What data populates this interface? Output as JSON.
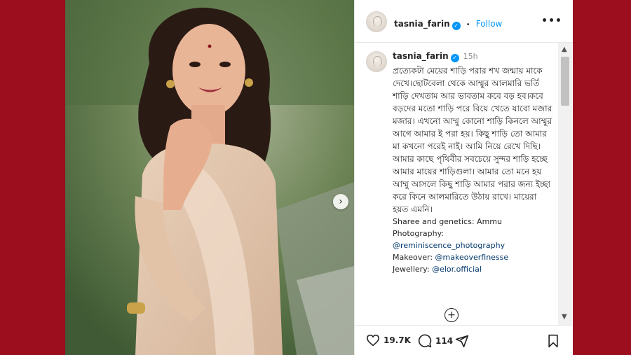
{
  "post": {
    "username": "tasnia_farin",
    "verified_symbol": "✓",
    "separator": "•",
    "follow_label": "Follow",
    "more_symbol": "•••",
    "time_ago": "15h",
    "caption": "প্রত্যেকটা মেয়ের শাড়ি পরার শখ জন্মায় মাকে দেখে।ছোটবেলা থেকে আম্মুর আলমারি ভর্তি শাড়ি দেখতাম আর ভাবতাম কবে বড় হব।কবে বড়দের মতো শাড়ি পরে বিয়ে খেতে যাবো মজার মজার। এখনো আম্মু কোনো শাড়ি কিনলে আম্মুর আগে আমার ই পরা হয়। কিছু শাড়ি তো আমার মা কখনো পরেই নাই। আমি নিয়ে রেখে দিছি।আমার কাছে পৃথিবীর সবচেয়ে সুন্দর শাড়ি হচ্ছে আমার মায়ের শাড়িগুলা। আমার তো মনে হয় আম্মু আসলে কিছু শাড়ি আমার পরার জন্য ইচ্ছা করে কিনে আলমারিতে উঠায় রাখে। মায়েরা হয়ত এমনি।",
    "credits": {
      "saree_label": "Sharee and genetics: Ammu",
      "photo_label": "Photography:",
      "photo_handle": "@reminiscence_photography",
      "makeover_label": "Makeover:",
      "makeover_handle": "@makeoverfinesse",
      "jewellery_label": "Jewellery:",
      "jewellery_handle": "@elor.official"
    }
  },
  "actions": {
    "likes": "19.7K",
    "comments": "114"
  },
  "icons": {
    "carousel_next": "chevron-right-icon",
    "load_more": "plus-circle-icon",
    "like": "heart-icon",
    "comment": "comment-icon",
    "share": "send-icon",
    "save": "bookmark-icon"
  },
  "colors": {
    "background": "#9c0d1d",
    "accent": "#0095f6",
    "link": "#00376b"
  }
}
